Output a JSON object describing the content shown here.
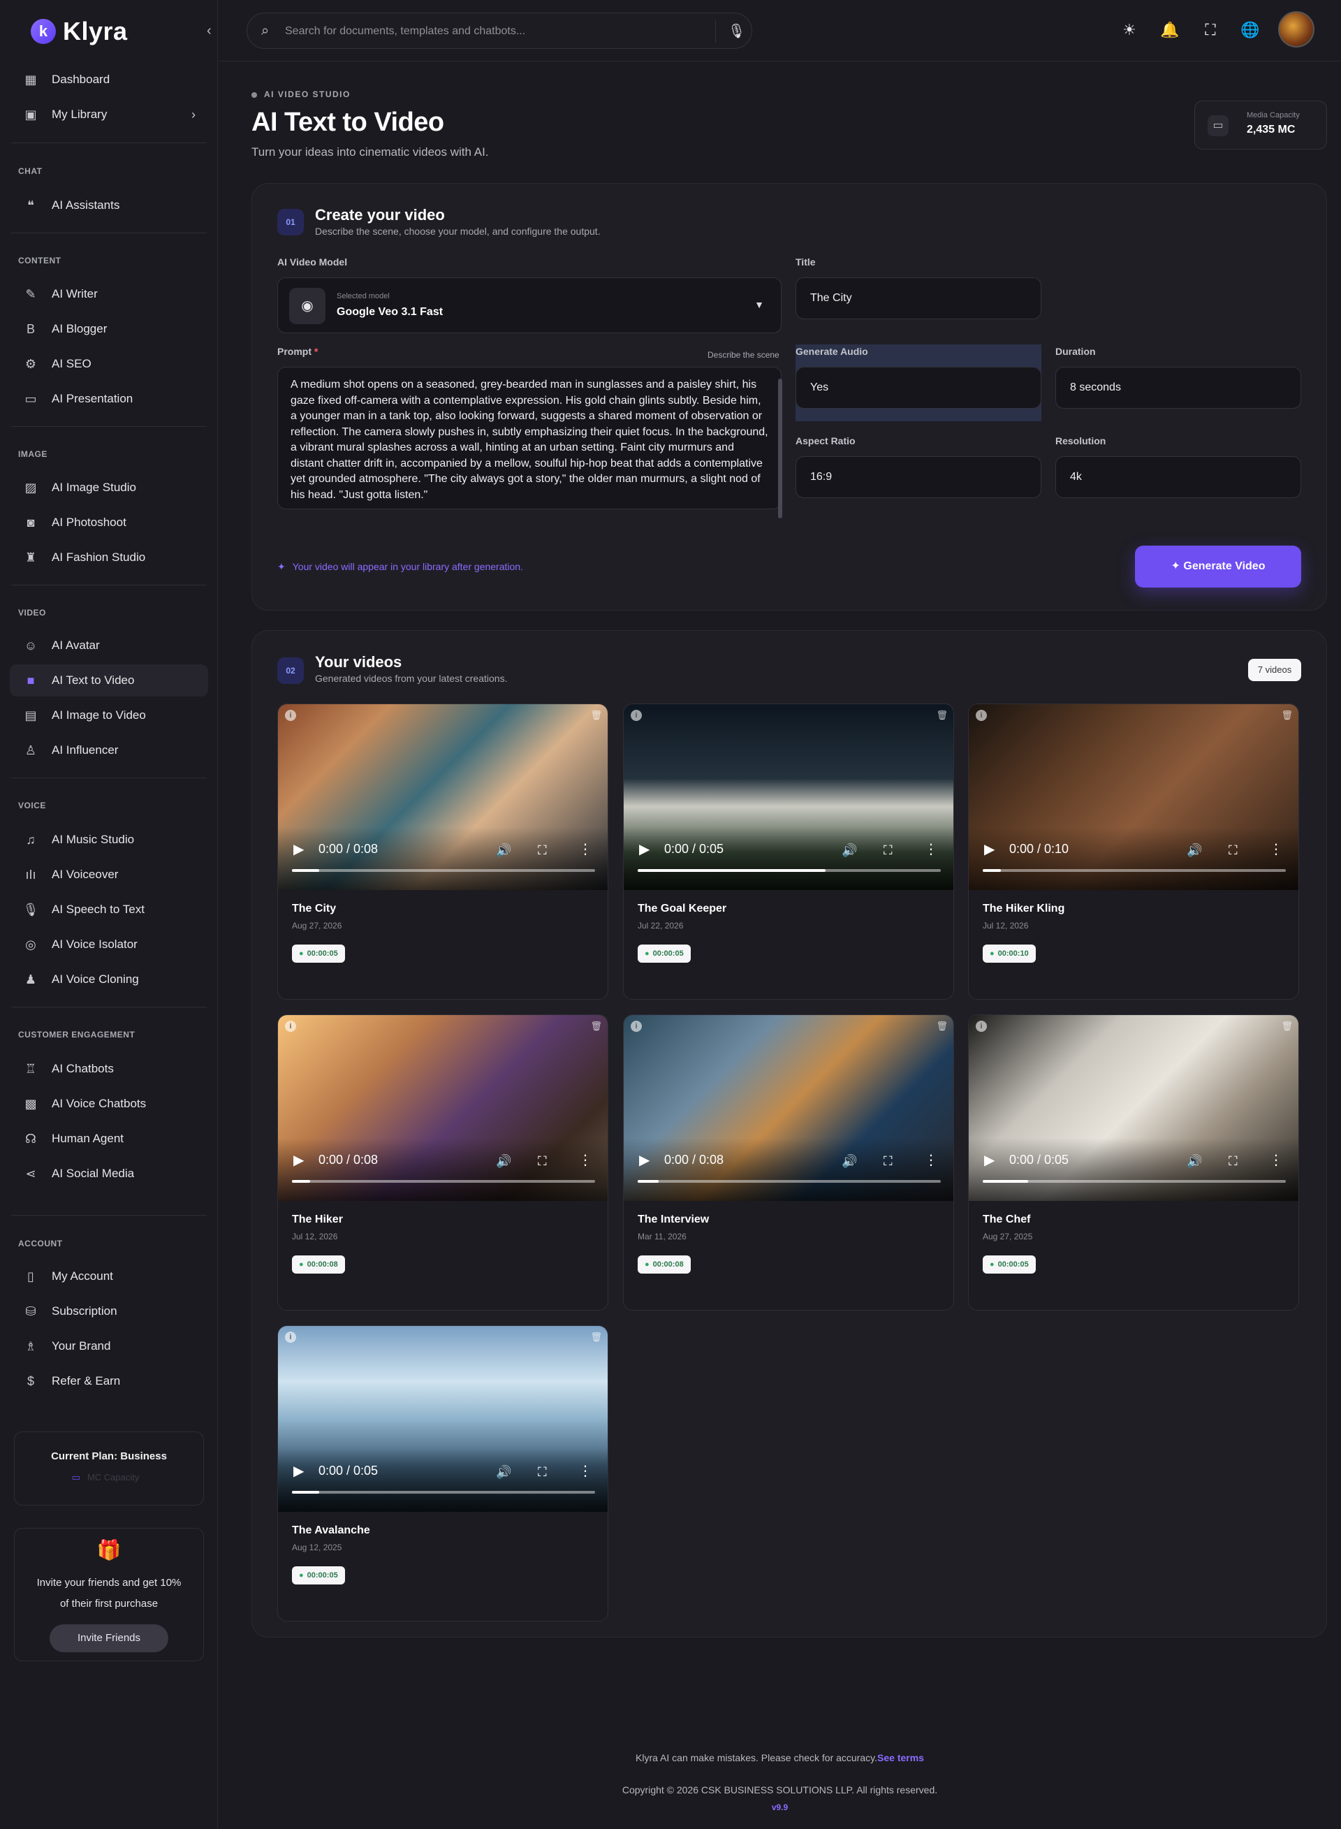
{
  "brand": {
    "name": "Klyra",
    "accent": "#6f4ef2"
  },
  "topbar": {
    "search_placeholder": "Search for documents, templates and chatbots..."
  },
  "sidebar": {
    "top_items": [
      {
        "label": "Dashboard",
        "icon": "map-icon"
      },
      {
        "label": "My Library",
        "icon": "folder-plus-icon"
      }
    ],
    "sections": {
      "chat": "CHAT",
      "content": "CONTENT",
      "image": "IMAGE",
      "video": "VIDEO",
      "voice": "VOICE",
      "customer": "CUSTOMER ENGAGEMENT",
      "account": "ACCOUNT"
    },
    "chat": [
      "AI Assistants"
    ],
    "content": [
      "AI Writer",
      "AI Blogger",
      "AI SEO",
      "AI Presentation"
    ],
    "image": [
      "AI Image Studio",
      "AI Photoshoot",
      "AI Fashion Studio"
    ],
    "video": [
      "AI Avatar",
      "AI Text to Video",
      "AI Image to Video",
      "AI Influencer"
    ],
    "voice": [
      "AI Music Studio",
      "AI Voiceover",
      "AI Speech to Text",
      "AI Voice Isolator",
      "AI Voice Cloning"
    ],
    "customer": [
      "AI Chatbots",
      "AI Voice Chatbots",
      "Human Agent",
      "AI Social Media"
    ],
    "account": [
      "My Account",
      "Subscription",
      "Your Brand",
      "Refer & Earn"
    ],
    "active": "AI Text to Video",
    "plan": {
      "title": "Current Plan: Business",
      "capacity": "MC Capacity"
    },
    "invite": {
      "text": "Invite your friends and get 10% of their first purchase",
      "button": "Invite Friends"
    }
  },
  "header": {
    "eyebrow": "AI VIDEO STUDIO",
    "title": "AI Text to Video",
    "subtitle": "Turn your ideas into cinematic videos with AI.",
    "capacity_label": "Media Capacity",
    "capacity_value": "2,435 MC"
  },
  "create": {
    "step": "01",
    "title": "Create your video",
    "subtitle": "Describe the scene, choose your model, and configure the output.",
    "model_label": "AI Video Model",
    "model_small": "Selected model",
    "model_value": "Google Veo 3.1 Fast",
    "title_label": "Title",
    "title_value": "The City",
    "prompt_label": "Prompt",
    "prompt_required": "*",
    "prompt_hint": "Describe the scene",
    "prompt_value": "A medium shot opens on a seasoned, grey-bearded man in sunglasses and a paisley shirt, his gaze fixed off-camera with a contemplative expression. His gold chain glints subtly. Beside him, a younger man in a tank top, also looking forward, suggests a shared moment of observation or reflection. The camera slowly pushes in, subtly emphasizing their quiet focus. In the background, a vibrant mural splashes across a wall, hinting at an urban setting. Faint city murmurs and distant chatter drift in, accompanied by a mellow, soulful hip-hop beat that adds a contemplative yet grounded atmosphere. \"The city always got a story,\" the older man murmurs, a slight nod of his head. \"Just gotta listen.\"",
    "audio_label": "Generate Audio",
    "audio_value": "Yes",
    "duration_label": "Duration",
    "duration_value": "8 seconds",
    "aspect_label": "Aspect Ratio",
    "aspect_value": "16:9",
    "resolution_label": "Resolution",
    "resolution_value": "4k",
    "note": "Your video will appear in your library after generation.",
    "generate_button": "Generate Video"
  },
  "videos": {
    "step": "02",
    "title": "Your videos",
    "subtitle": "Generated videos from your latest creations.",
    "count": "7 videos",
    "items": [
      {
        "title": "The City",
        "date": "Aug 27, 2026",
        "duration": "00:00:05",
        "time": "0:00 / 0:08",
        "progress": 0.09
      },
      {
        "title": "The Goal Keeper",
        "date": "Jul 22, 2026",
        "duration": "00:00:05",
        "time": "0:00 / 0:05",
        "progress": 0.62
      },
      {
        "title": "The Hiker Kling",
        "date": "Jul 12, 2026",
        "duration": "00:00:10",
        "time": "0:00 / 0:10",
        "progress": 0.06
      },
      {
        "title": "The Hiker",
        "date": "Jul 12, 2026",
        "duration": "00:00:08",
        "time": "0:00 / 0:08",
        "progress": 0.06
      },
      {
        "title": "The Interview",
        "date": "Mar 11, 2026",
        "duration": "00:00:08",
        "time": "0:00 / 0:08",
        "progress": 0.07
      },
      {
        "title": "The Chef",
        "date": "Aug 27, 2025",
        "duration": "00:00:05",
        "time": "0:00 / 0:05",
        "progress": 0.15
      },
      {
        "title": "The Avalanche",
        "date": "Aug 12, 2025",
        "duration": "00:00:05",
        "time": "0:00 / 0:05",
        "progress": 0.09
      }
    ]
  },
  "footer": {
    "disclaimer": "Klyra AI can make mistakes. Please check for accuracy.",
    "terms": "See terms",
    "copyright": "Copyright © 2026 CSK BUSINESS SOLUTIONS LLP. All rights reserved.",
    "version": "v9.9"
  }
}
